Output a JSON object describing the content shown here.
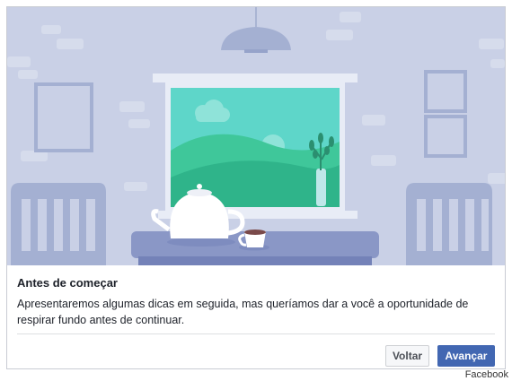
{
  "dialog": {
    "title": "Antes de começar",
    "body": "Apresentaremos algumas dicas em seguida, mas queríamos dar a você a oportunidade de respirar fundo antes de continuar.",
    "back_label": "Voltar",
    "next_label": "Avançar"
  },
  "credit": "Facebook",
  "colors": {
    "wall": "#c9d0e6",
    "accent": "#4267b2",
    "window_sky": "#5ed6c9",
    "hills": "#2fbf8f"
  },
  "icons": [
    "pendant-lamp-icon",
    "teapot-icon",
    "cup-icon",
    "plant-vase-icon"
  ]
}
